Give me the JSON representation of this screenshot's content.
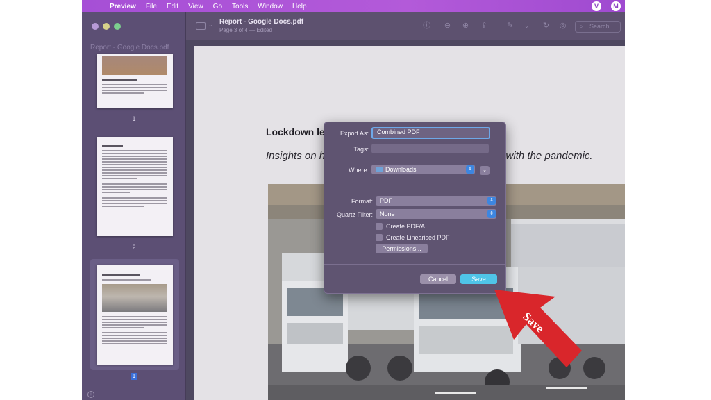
{
  "menubar": {
    "items": [
      "Preview",
      "File",
      "Edit",
      "View",
      "Go",
      "Tools",
      "Window",
      "Help"
    ],
    "right_icons": [
      "vpn-icon",
      "account-icon"
    ]
  },
  "window": {
    "title": "Report - Google Docs.pdf",
    "subtitle": "Page 3 of 4 — Edited",
    "search_placeholder": "Search"
  },
  "sidebar": {
    "title": "Report - Google Docs.pdf",
    "pages": [
      "1",
      "2",
      "1"
    ],
    "selected_index": 2
  },
  "document": {
    "heading_visible": "Lockdown le",
    "subtitle_left": "Insights on h",
    "subtitle_right": "g with the pandemic."
  },
  "dialog": {
    "export_as_label": "Export As:",
    "export_as_value": "Combined PDF",
    "tags_label": "Tags:",
    "tags_value": "",
    "where_label": "Where:",
    "where_value": "Downloads",
    "format_label": "Format:",
    "format_value": "PDF",
    "quartz_label": "Quartz Filter:",
    "quartz_value": "None",
    "create_pdfa_label": "Create PDF/A",
    "create_pdfa_checked": false,
    "create_linearised_label": "Create Linearised PDF",
    "create_linearised_checked": false,
    "permissions_label": "Permissions...",
    "cancel_label": "Cancel",
    "save_label": "Save"
  },
  "annotation": {
    "text": "Save",
    "color": "#d9262b"
  }
}
